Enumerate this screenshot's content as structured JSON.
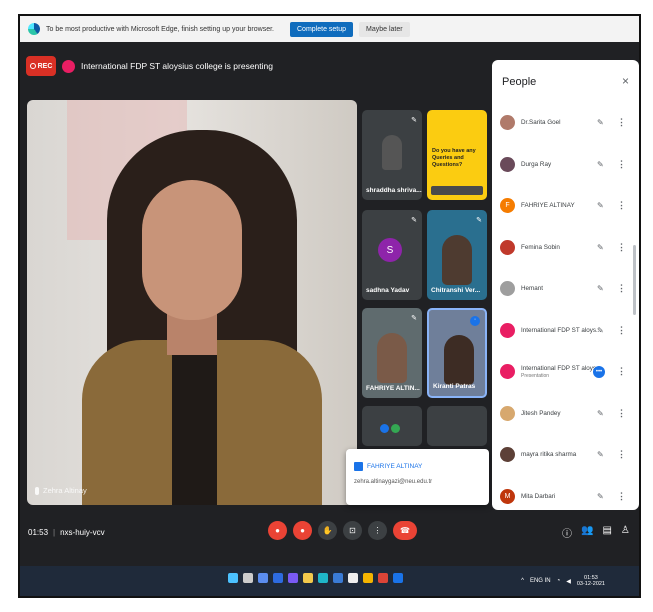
{
  "edge_bar": {
    "message": "To be most productive with Microsoft Edge, finish setting up your browser.",
    "primary_button": "Complete setup",
    "secondary_button": "Maybe later"
  },
  "meeting": {
    "rec_label": "REC",
    "presenting_text": "International FDP ST aloysius college is presenting",
    "main_speaker_name": "Zehra Altinay",
    "time": "01:53",
    "meeting_code": "nxs-huiy-vcv"
  },
  "tiles": [
    {
      "label": "shraddha shriva..."
    },
    {
      "label": "Do you have any Queries and Questions?"
    },
    {
      "label": "sadhna Yadav",
      "avatar": "S"
    },
    {
      "label": "Chitranshi Ver..."
    },
    {
      "label": "FAHRIYE ALTIN..."
    },
    {
      "label": "Kiranti Patras"
    },
    {
      "label": ""
    },
    {
      "label": ""
    }
  ],
  "popup": {
    "name": "FAHRIYE ALTINAY",
    "email": "zehra.altinaygazi@neu.edu.tr"
  },
  "people_panel": {
    "title": "People",
    "close": "×",
    "participants": [
      {
        "name": "Dr.Sarita Goel",
        "sub": ""
      },
      {
        "name": "Durga Ray",
        "sub": ""
      },
      {
        "name": "FAHRIYE ALTINAY",
        "sub": "",
        "initial": "F"
      },
      {
        "name": "Femina Sobin",
        "sub": ""
      },
      {
        "name": "Hemant",
        "sub": ""
      },
      {
        "name": "International FDP ST aloys...",
        "sub": ""
      },
      {
        "name": "International FDP ST aloys...",
        "sub": "Presentation"
      },
      {
        "name": "Jitesh Pandey",
        "sub": ""
      },
      {
        "name": "mayra ritika sharma",
        "sub": ""
      },
      {
        "name": "Mita Darbari",
        "sub": "",
        "initial": "M"
      }
    ]
  },
  "taskbar": {
    "lang": "ENG IN",
    "time": "01:53",
    "date": "03-12-2021"
  }
}
